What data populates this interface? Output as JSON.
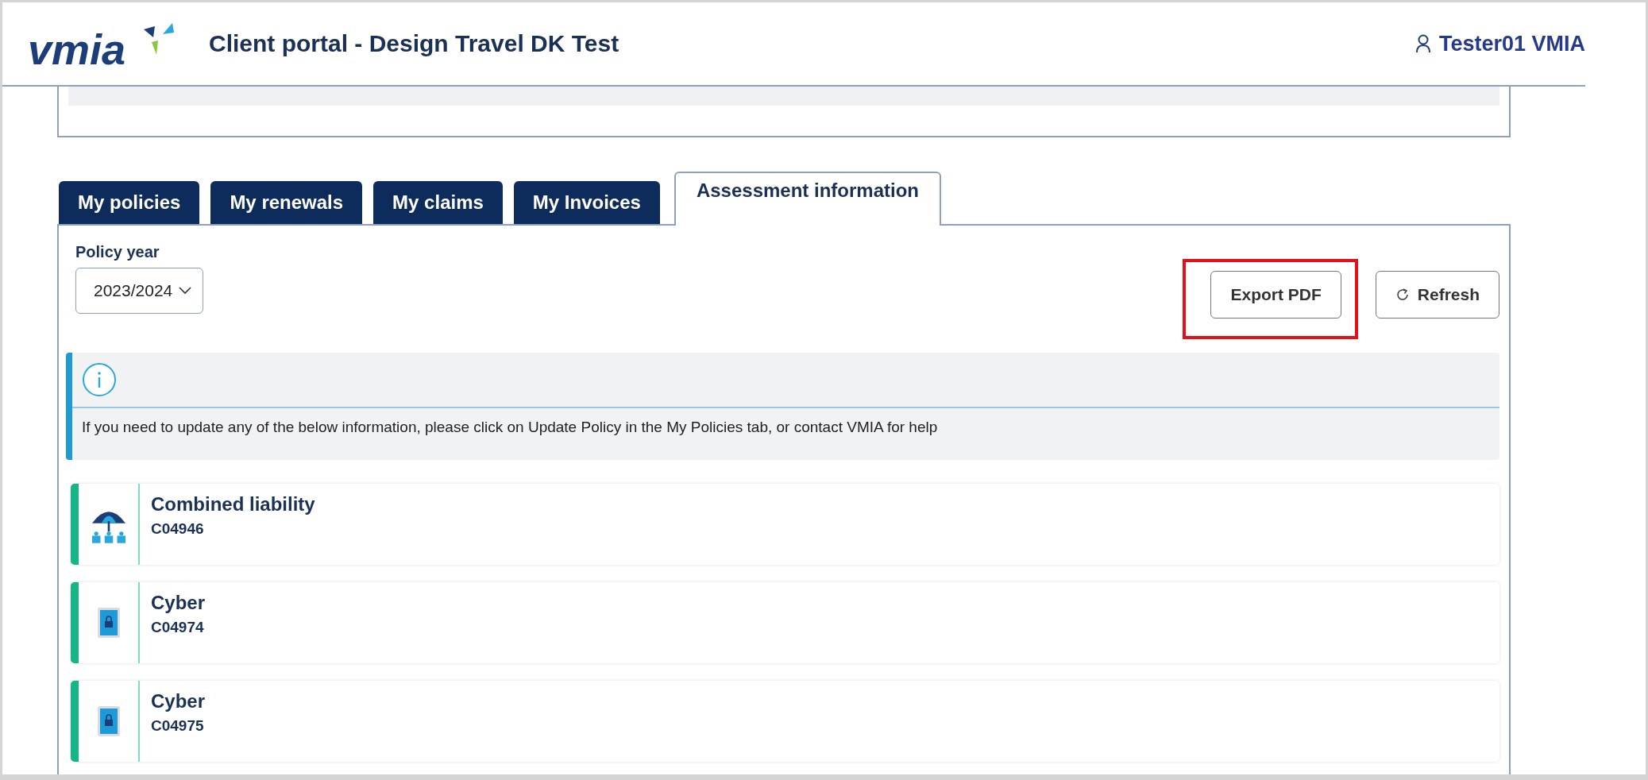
{
  "header": {
    "logo": "vmia",
    "title": "Client portal - Design Travel DK Test",
    "user": "Tester01 VMIA"
  },
  "tabs": [
    {
      "label": "My policies",
      "selected": false
    },
    {
      "label": "My renewals",
      "selected": false
    },
    {
      "label": "My claims",
      "selected": false
    },
    {
      "label": "My Invoices",
      "selected": false
    },
    {
      "label": "Assessment information",
      "selected": true
    }
  ],
  "policy_year": {
    "label": "Policy year",
    "value": "2023/2024"
  },
  "buttons": [
    {
      "kind": "export",
      "label": "Export PDF",
      "highlighted": true
    },
    {
      "kind": "refresh",
      "label": "Refresh",
      "highlighted": false
    }
  ],
  "info": {
    "text": "If you need to update any of the below information, please click on Update Policy in the My Policies tab, or contact VMIA for help"
  },
  "policies": [
    {
      "kind": "liability",
      "name": "Combined liability",
      "code": "C04946"
    },
    {
      "kind": "cyber",
      "name": "Cyber",
      "code": "C04974"
    },
    {
      "kind": "cyber",
      "name": "Cyber",
      "code": "C04975"
    }
  ]
}
